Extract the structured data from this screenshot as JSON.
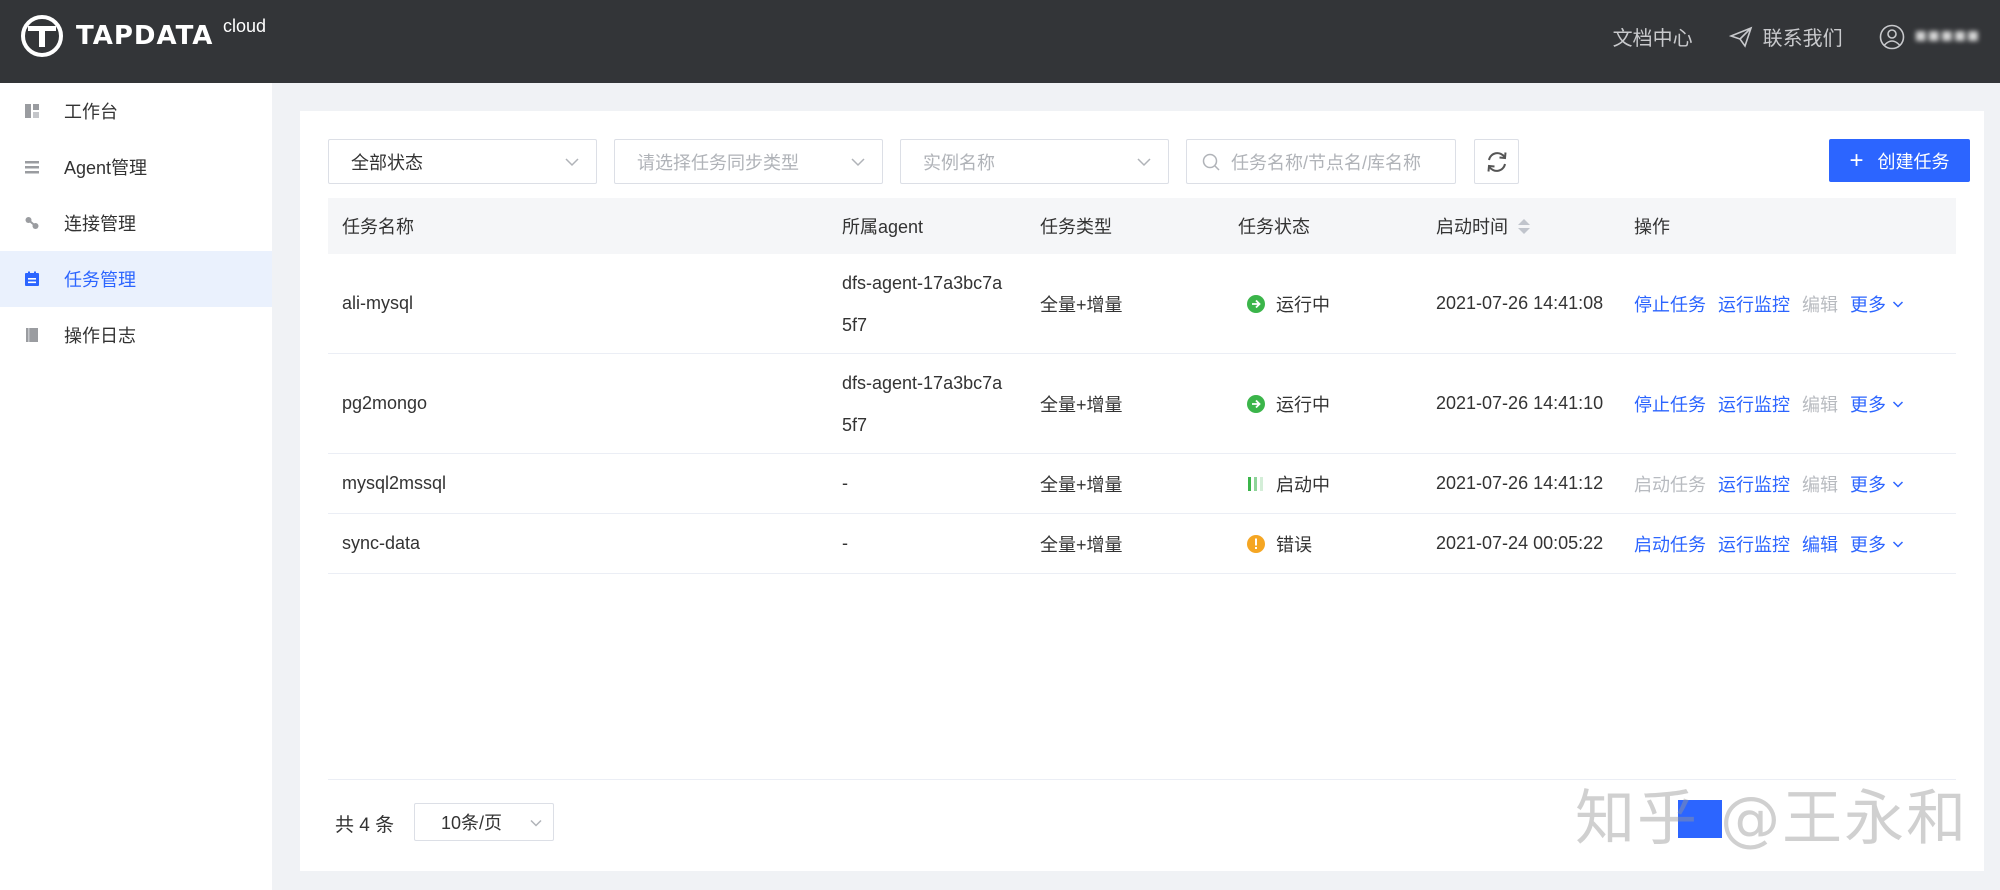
{
  "brand": {
    "name": "TAPDATA",
    "sup": "cloud"
  },
  "header": {
    "docs_label": "文档中心",
    "contact_label": "联系我们",
    "user_name": "■■■■■"
  },
  "sidebar": {
    "items": [
      {
        "label": "工作台",
        "icon": "dashboard-icon"
      },
      {
        "label": "Agent管理",
        "icon": "list-icon"
      },
      {
        "label": "连接管理",
        "icon": "link-icon"
      },
      {
        "label": "任务管理",
        "icon": "task-icon",
        "active": true
      },
      {
        "label": "操作日志",
        "icon": "log-icon"
      }
    ]
  },
  "filters": {
    "status": "全部状态",
    "sync_type_placeholder": "请选择任务同步类型",
    "instance_placeholder": "实例名称",
    "search_placeholder": "任务名称/节点名/库名称",
    "create_label": "创建任务"
  },
  "table": {
    "headers": [
      "任务名称",
      "所属agent",
      "任务类型",
      "任务状态",
      "启动时间",
      "操作"
    ],
    "rows": [
      {
        "name": "ali-mysql",
        "agent": "dfs-agent-17a3bc7a5f7",
        "type": "全量+增量",
        "status": "运行中",
        "status_kind": "running",
        "time": "2021-07-26 14:41:08",
        "op1": "停止任务",
        "op1_disabled": false,
        "op2": "运行监控",
        "op3": "编辑",
        "op3_disabled": true,
        "op4": "更多"
      },
      {
        "name": "pg2mongo",
        "agent": "dfs-agent-17a3bc7a5f7",
        "type": "全量+增量",
        "status": "运行中",
        "status_kind": "running",
        "time": "2021-07-26 14:41:10",
        "op1": "停止任务",
        "op1_disabled": false,
        "op2": "运行监控",
        "op3": "编辑",
        "op3_disabled": true,
        "op4": "更多"
      },
      {
        "name": "mysql2mssql",
        "agent": "-",
        "type": "全量+增量",
        "status": "启动中",
        "status_kind": "starting",
        "time": "2021-07-26 14:41:12",
        "op1": "启动任务",
        "op1_disabled": true,
        "op2": "运行监控",
        "op3": "编辑",
        "op3_disabled": true,
        "op4": "更多"
      },
      {
        "name": "sync-data",
        "agent": "-",
        "type": "全量+增量",
        "status": "错误",
        "status_kind": "error",
        "time": "2021-07-24 00:05:22",
        "op1": "启动任务",
        "op1_disabled": false,
        "op2": "运行监控",
        "op3": "编辑",
        "op3_disabled": false,
        "op4": "更多"
      }
    ]
  },
  "footer": {
    "total": "共 4 条",
    "page_size": "10条/页"
  },
  "watermark": "知乎 @王永和",
  "colors": {
    "primary": "#2c65ff",
    "topbar": "#333538",
    "running": "#3bb54a",
    "error": "#f5a623"
  }
}
